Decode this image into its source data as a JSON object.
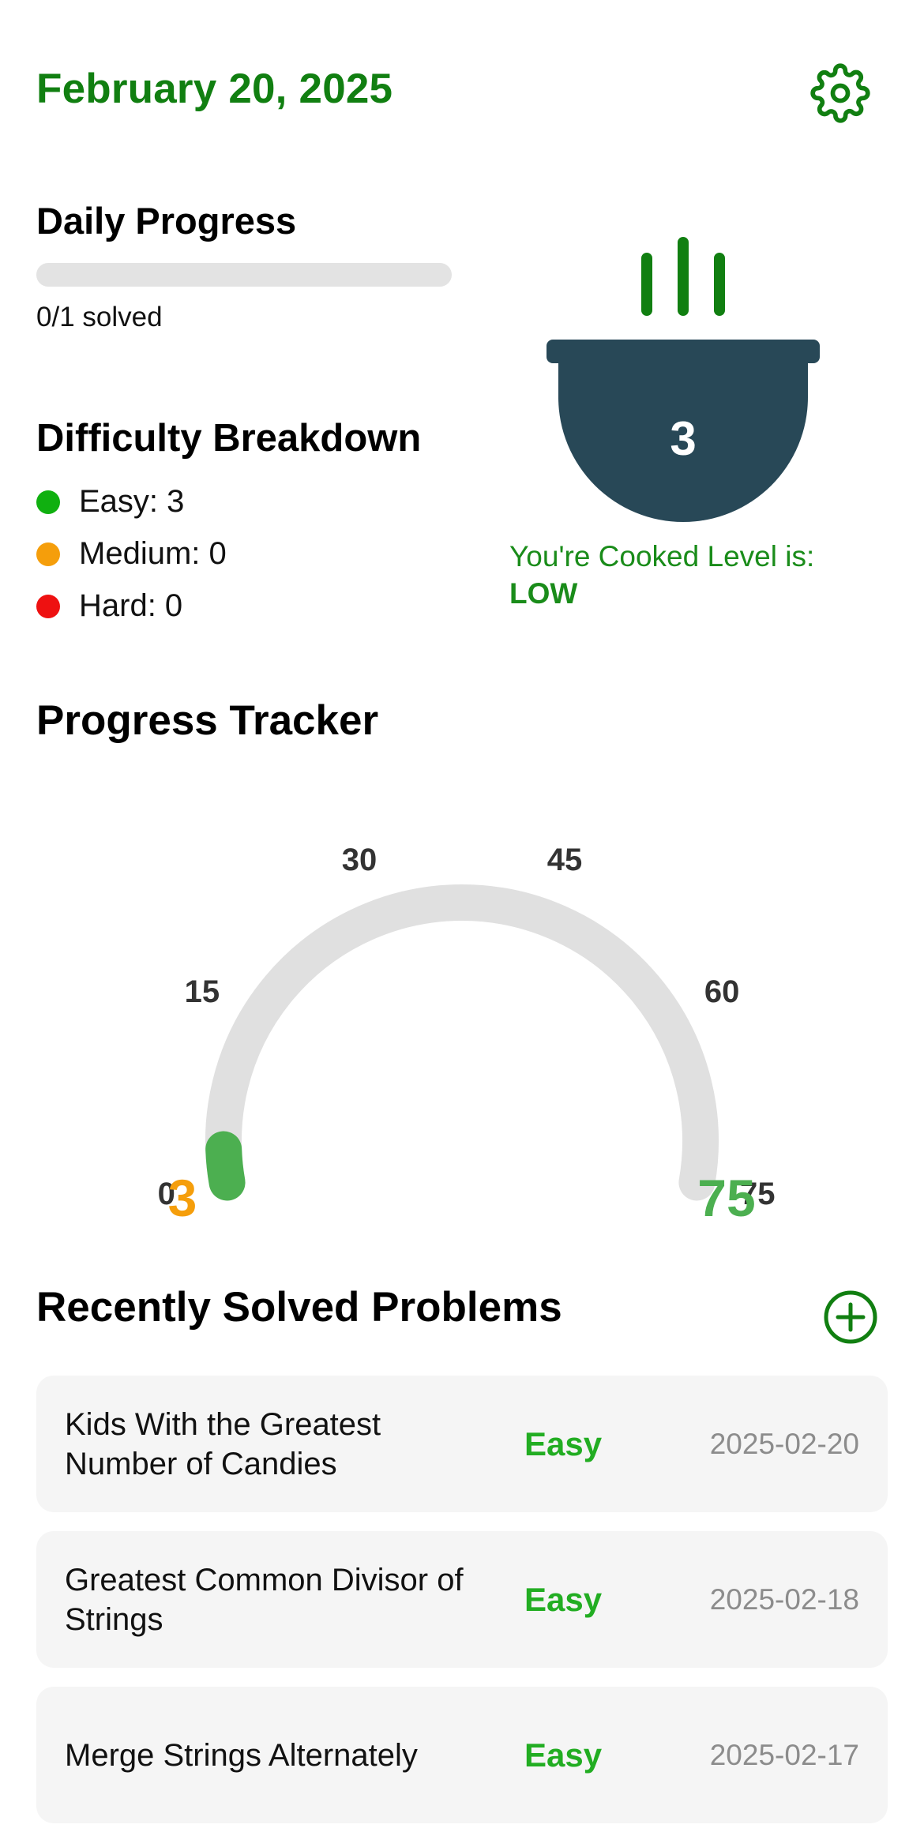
{
  "header": {
    "date": "February 20, 2025",
    "settings_icon": "gear-icon"
  },
  "daily_progress": {
    "title": "Daily Progress",
    "solved": 0,
    "goal": 1,
    "solved_text": "0/1 solved"
  },
  "difficulty": {
    "title": "Difficulty Breakdown",
    "items": [
      {
        "label": "Easy: 3",
        "color": "#10b010"
      },
      {
        "label": "Medium: 0",
        "color": "#f59e0b"
      },
      {
        "label": "Hard: 0",
        "color": "#ee1111"
      }
    ]
  },
  "pot": {
    "count": "3",
    "label": "You're Cooked Level is:",
    "level": "LOW",
    "color": "#284857",
    "steam_color": "#117f11"
  },
  "tracker": {
    "title": "Progress Tracker",
    "min": 0,
    "max": 75,
    "value": 3,
    "ticks": [
      "0",
      "15",
      "30",
      "45",
      "60",
      "75"
    ],
    "current_label": "3",
    "goal_label": "75",
    "current_color": "#f59e0b",
    "goal_color": "#4caf50"
  },
  "recent": {
    "title": "Recently Solved Problems",
    "add_icon": "plus-circle-icon",
    "problems": [
      {
        "title": "Kids With the Greatest Number of Candies",
        "difficulty": "Easy",
        "date": "2025-02-20"
      },
      {
        "title": "Greatest Common Divisor of Strings",
        "difficulty": "Easy",
        "date": "2025-02-18"
      },
      {
        "title": "Merge Strings Alternately",
        "difficulty": "Easy",
        "date": "2025-02-17"
      }
    ]
  }
}
